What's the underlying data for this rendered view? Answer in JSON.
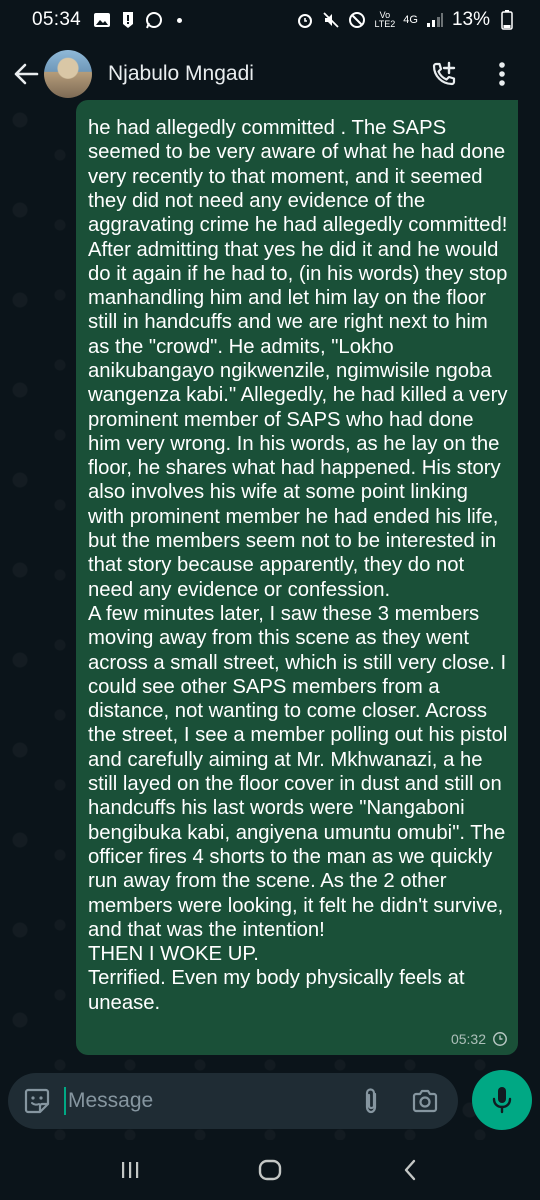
{
  "status_bar": {
    "time": "05:34",
    "battery": "13%",
    "network": "4G",
    "volte": "LTE2"
  },
  "header": {
    "contact_name": "Njabulo Mngadi"
  },
  "message": {
    "text": "he had allegedly committed . The SAPS seemed to be very aware of what he had done very recently to that moment,  and it seemed they did not need any evidence of the aggravating crime he had allegedly committed! After admitting that yes he did it and he would do it again if he had to, (in his words) they stop manhandling  him and let him lay on the floor still in handcuffs and we are right next to him as the \"crowd\". He admits, \"Lokho anikubangayo ngikwenzile, ngimwisile ngoba wangenza kabi.\" Allegedly, he had killed a very prominent member of SAPS who had done him very wrong. In his words, as he lay on the floor, he shares what had happened. His story also involves his wife at some point linking with prominent member he had ended his life, but the members seem not to be interested in that story because apparently, they do not need any evidence or confession.\nA few minutes later, I saw these 3 members moving away from this scene as they went across a small street, which is still very close. I could see other SAPS members from a distance, not wanting to come closer. Across the street, I see a member polling out his pistol and carefully aiming at Mr. Mkhwanazi, a he still layed on the floor cover in dust and still on handcuffs his last words were \"Nangaboni bengibuka kabi, angiyena umuntu omubi\". The officer fires 4 shorts to the man as we quickly run away from the scene. As the 2 other members were looking, it felt he didn't survive, and that was the intention!\nTHEN I WOKE UP.\nTerrified. Even my body physically feels at unease.",
    "time": "05:32"
  },
  "composer": {
    "placeholder": "Message"
  },
  "colors": {
    "bubble": "#1a5038",
    "accent": "#00a884",
    "background": "#0b141a",
    "composer": "#1f2c34"
  }
}
